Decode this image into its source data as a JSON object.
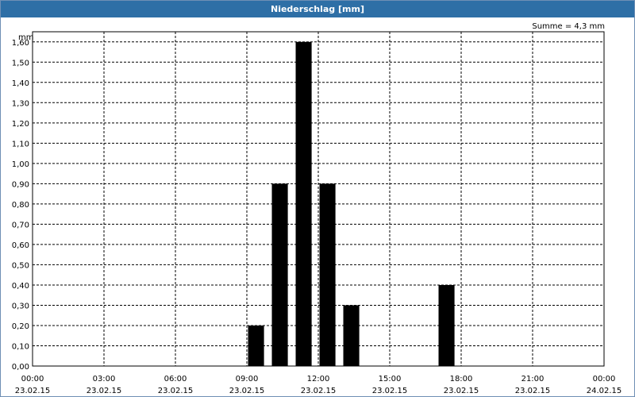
{
  "window": {
    "title": "Niederschlag [mm]"
  },
  "chart_data": {
    "type": "bar",
    "title": "Niederschlag [mm]",
    "ylabel": "mm",
    "annotation": "Summe = 4,3 mm",
    "ylim": [
      0,
      1.65
    ],
    "yticks": [
      0,
      0.1,
      0.2,
      0.3,
      0.4,
      0.5,
      0.6,
      0.7,
      0.8,
      0.9,
      1.0,
      1.1,
      1.2,
      1.3,
      1.4,
      1.5,
      1.6
    ],
    "ytick_labels": [
      "0,00",
      "0,10",
      "0,20",
      "0,30",
      "0,40",
      "0,50",
      "0,60",
      "0,70",
      "0,80",
      "0,90",
      "1,00",
      "1,10",
      "1,20",
      "1,30",
      "1,40",
      "1,50",
      "1,60"
    ],
    "x_range_hours": [
      0,
      24
    ],
    "xticks": [
      {
        "hour": 0,
        "time": "00:00",
        "date": "23.02.15"
      },
      {
        "hour": 3,
        "time": "03:00",
        "date": "23.02.15"
      },
      {
        "hour": 6,
        "time": "06:00",
        "date": "23.02.15"
      },
      {
        "hour": 9,
        "time": "09:00",
        "date": "23.02.15"
      },
      {
        "hour": 12,
        "time": "12:00",
        "date": "23.02.15"
      },
      {
        "hour": 15,
        "time": "15:00",
        "date": "23.02.15"
      },
      {
        "hour": 18,
        "time": "18:00",
        "date": "23.02.15"
      },
      {
        "hour": 21,
        "time": "21:00",
        "date": "23.02.15"
      },
      {
        "hour": 24,
        "time": "00:00",
        "date": "24.02.15"
      }
    ],
    "bars": [
      {
        "hour": 9,
        "value": 0.2
      },
      {
        "hour": 10,
        "value": 0.9
      },
      {
        "hour": 11,
        "value": 1.6
      },
      {
        "hour": 12,
        "value": 0.9
      },
      {
        "hour": 13,
        "value": 0.3
      },
      {
        "hour": 17,
        "value": 0.4
      }
    ],
    "bar_color": "#000000",
    "grid": true
  }
}
